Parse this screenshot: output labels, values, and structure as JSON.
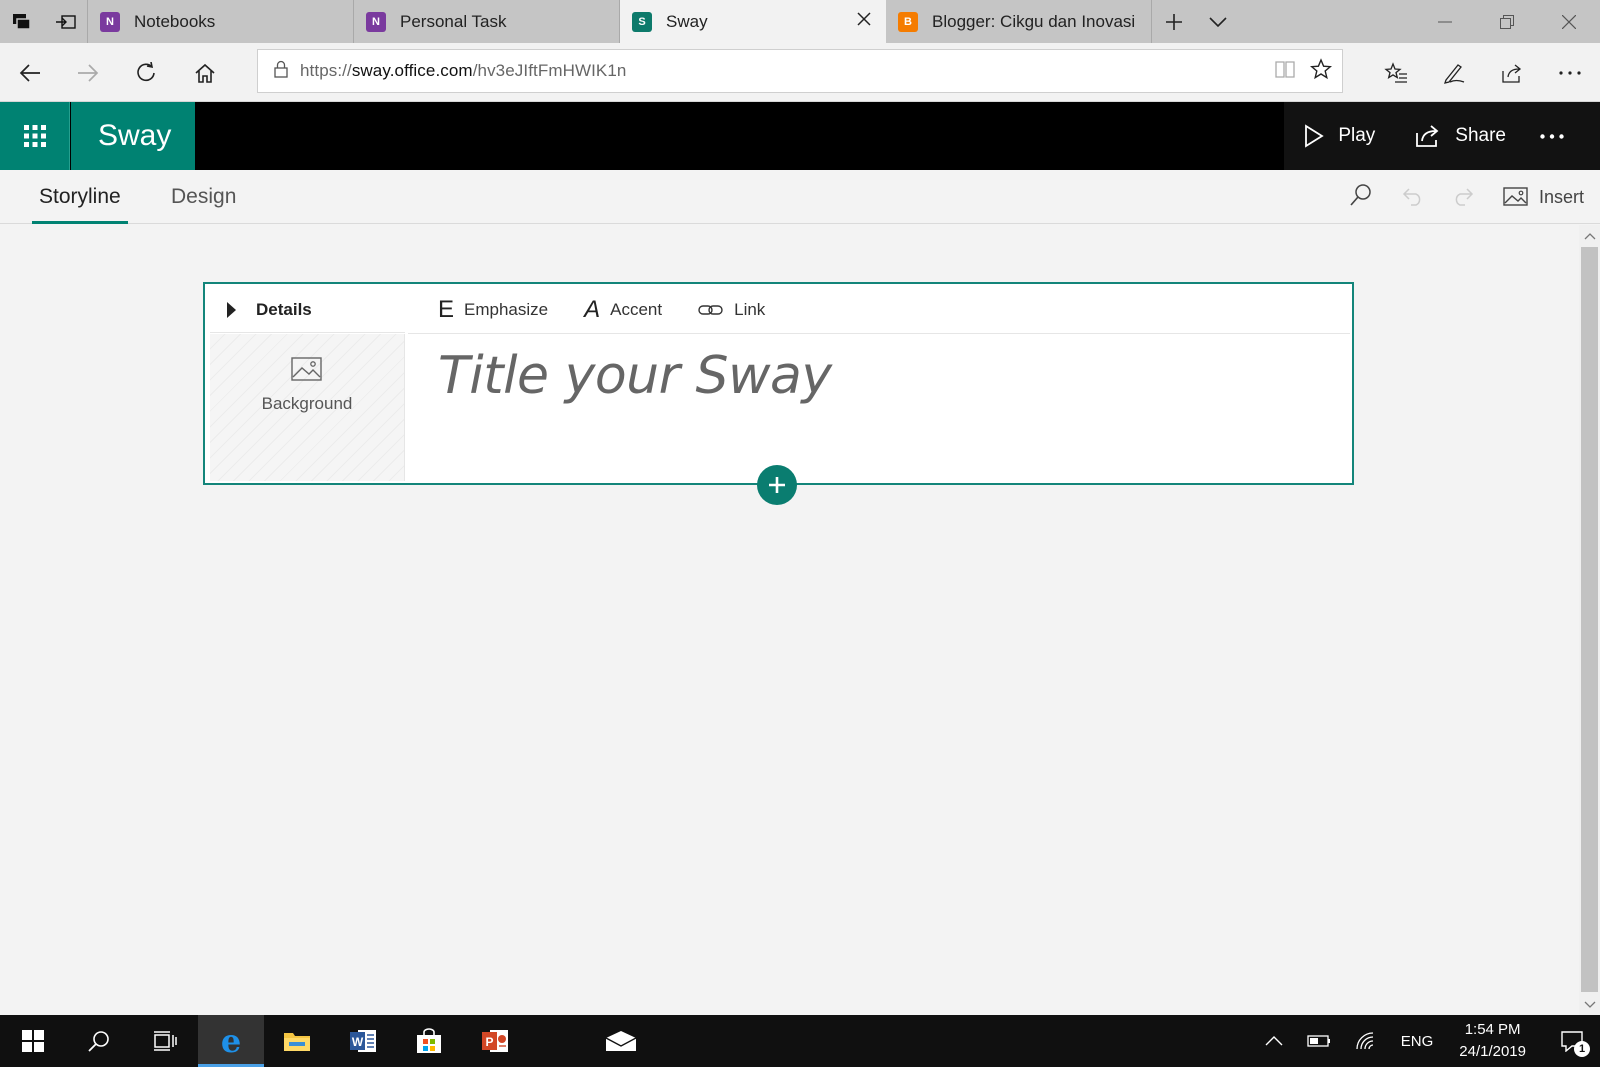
{
  "browser": {
    "tabs": [
      {
        "label": "Notebooks",
        "favicon": "onenote-icon",
        "color": "#7a3a9e",
        "glyph": "N",
        "active": false
      },
      {
        "label": "Personal Task",
        "favicon": "onenote-icon",
        "color": "#7a3a9e",
        "glyph": "N",
        "active": false
      },
      {
        "label": "Sway",
        "favicon": "sway-icon",
        "color": "#0d7a6b",
        "glyph": "S",
        "active": true
      },
      {
        "label": "Blogger: Cikgu dan Inovasi",
        "favicon": "blogger-icon",
        "color": "#f57c00",
        "glyph": "B",
        "active": false
      }
    ],
    "url_prefix": "https://",
    "url_host": "sway.office.com",
    "url_path": "/hv3eJIftFmHWIK1n"
  },
  "sway": {
    "brand": "Sway",
    "accent": "#008272",
    "play_label": "Play",
    "share_label": "Share"
  },
  "toolbar": {
    "tab_storyline": "Storyline",
    "tab_design": "Design",
    "insert_label": "Insert"
  },
  "card": {
    "details_label": "Details",
    "background_label": "Background",
    "emphasize_label": "Emphasize",
    "emphasize_glyph": "E",
    "accent_label": "Accent",
    "accent_glyph": "A",
    "link_label": "Link",
    "title_placeholder": "Title your Sway"
  },
  "taskbar": {
    "lang": "ENG",
    "time": "1:54 PM",
    "date": "24/1/2019",
    "notification_count": "1"
  }
}
